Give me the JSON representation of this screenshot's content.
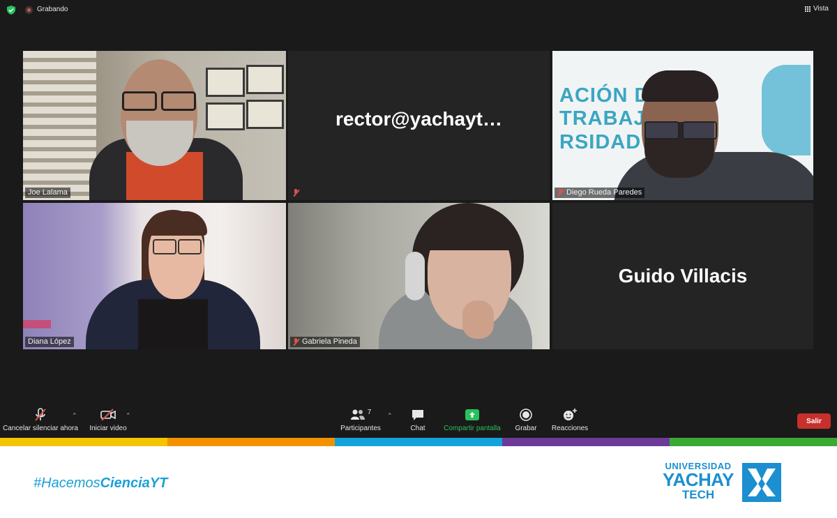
{
  "topbar": {
    "recording_label": "Grabando",
    "view_label": "Vista"
  },
  "participants": [
    {
      "name": "Joe Lalama",
      "muted": false,
      "active_speaker": true,
      "video": true
    },
    {
      "name": "",
      "display_text": "rector@yachayt…",
      "muted": true,
      "video": false
    },
    {
      "name": "Diego Rueda Paredes",
      "muted": true,
      "video": true
    },
    {
      "name": "Diana López",
      "muted": false,
      "video": true
    },
    {
      "name": "Gabriela Pineda",
      "muted": true,
      "video": true
    },
    {
      "name": "",
      "display_text": "Guido Villacis",
      "muted": false,
      "video": false
    }
  ],
  "controls": {
    "unmute_label": "Cancelar silenciar ahora",
    "start_video_label": "Iniciar video",
    "participants_label": "Participantes",
    "participants_count": "7",
    "chat_label": "Chat",
    "share_label": "Compartir pantalla",
    "record_label": "Grabar",
    "reactions_label": "Reacciones",
    "leave_label": "Salir"
  },
  "footer": {
    "hashtag_prefix": "#Hacemos",
    "hashtag_bold": "CienciaYT",
    "logo_line1": "UNIVERSIDAD",
    "logo_line2": "YACHAY",
    "logo_line3": "TECH"
  },
  "colors": {
    "active_speaker_border": "#e3ea7a",
    "share_green": "#27c25a",
    "leave_red": "#c8302b",
    "brand_blue": "#1b8fcf",
    "stripe": [
      "#f5c400",
      "#f39200",
      "#12a3df",
      "#6c3b97",
      "#3aaa35"
    ]
  }
}
